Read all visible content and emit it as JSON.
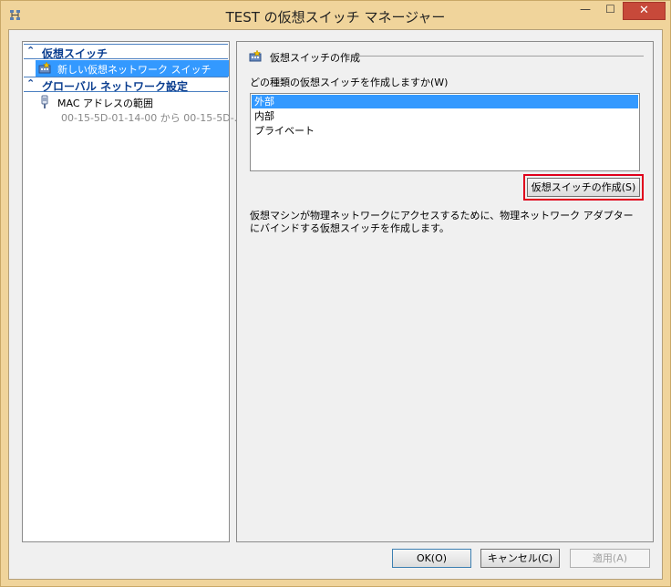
{
  "window": {
    "title": "TEST の仮想スイッチ マネージャー",
    "minimize_glyph": "—",
    "maximize_glyph": "☐",
    "close_glyph": "✕"
  },
  "tree": {
    "cat1": {
      "chevron": "⌃",
      "label": "仮想スイッチ"
    },
    "item1": {
      "label": "新しい仮想ネットワーク スイッチ"
    },
    "cat2": {
      "chevron": "⌃",
      "label": "グローバル ネットワーク設定"
    },
    "item2": {
      "label": "MAC アドレスの範囲",
      "sub": "00-15-5D-01-14-00 から 00-15-5D-..."
    }
  },
  "panel": {
    "section_title": "仮想スイッチの作成",
    "prompt": "どの種類の仮想スイッチを作成しますか(W)",
    "options": [
      "外部",
      "内部",
      "プライベート"
    ],
    "selected_index": 0,
    "create_button": "仮想スイッチの作成(S)",
    "description": "仮想マシンが物理ネットワークにアクセスするために、物理ネットワーク アダプターにバインドする仮想スイッチを作成します。"
  },
  "buttons": {
    "ok": "OK(O)",
    "cancel": "キャンセル(C)",
    "apply": "適用(A)"
  },
  "colors": {
    "accent": "#3399ff",
    "highlight_border": "#e0001b",
    "frame": "#f0d49b"
  }
}
